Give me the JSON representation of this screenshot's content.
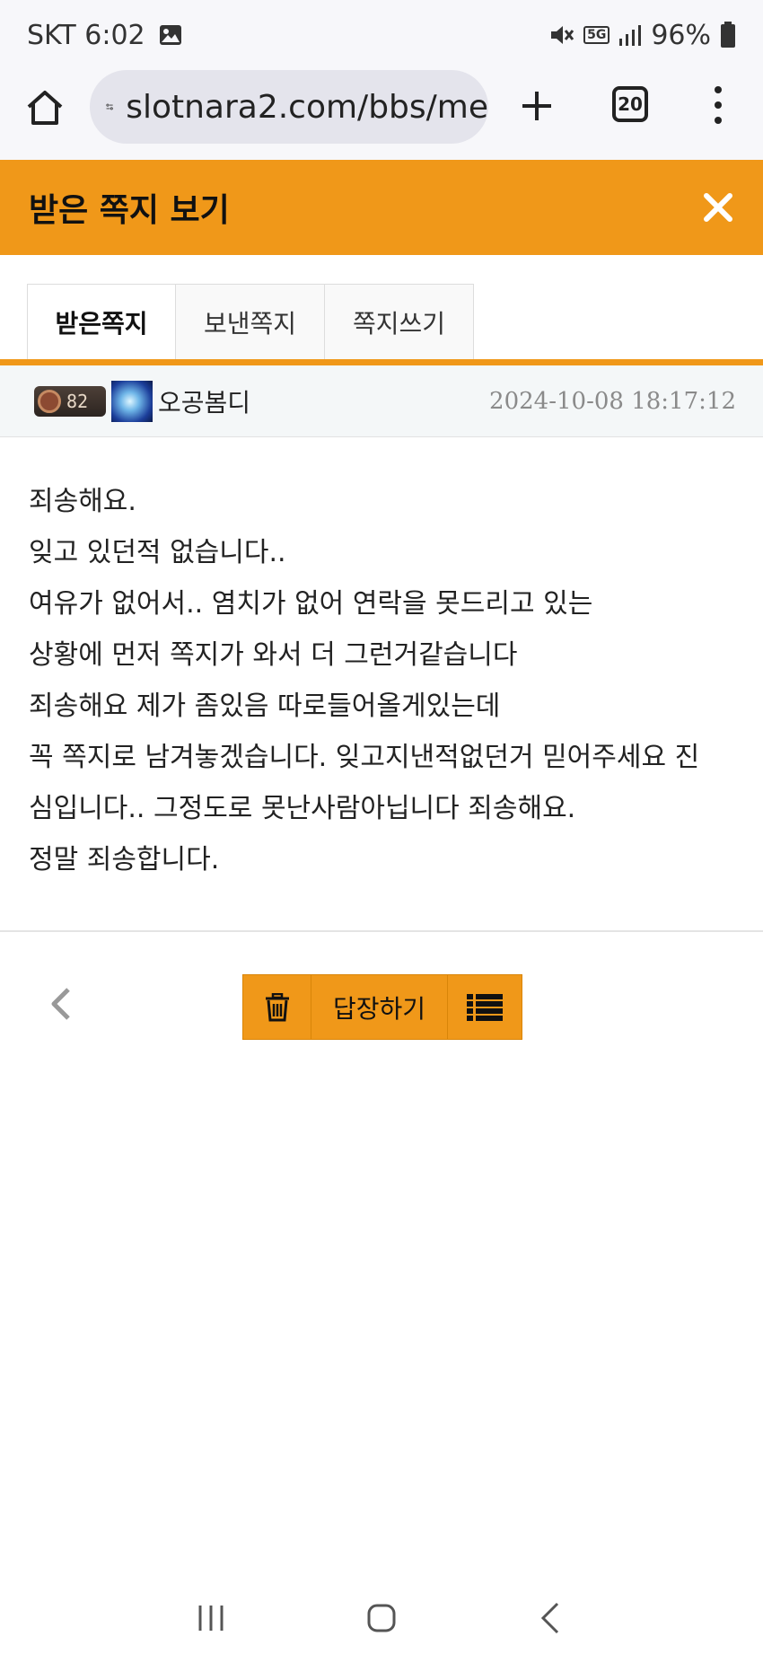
{
  "status_bar": {
    "carrier_time": "SKT 6:02",
    "network": "5G",
    "battery": "96%",
    "icons": [
      "image-icon",
      "mute-icon",
      "signal-icon",
      "battery-icon"
    ]
  },
  "browser": {
    "url": "slotnara2.com/bbs/me",
    "tab_count": "20",
    "icons": [
      "home-icon",
      "site-settings-icon",
      "plus-icon",
      "menu-icon"
    ]
  },
  "header": {
    "title": "받은 쪽지 보기",
    "accent_color": "#f09819"
  },
  "tabs": [
    {
      "label": "받은쪽지",
      "active": true
    },
    {
      "label": "보낸쪽지",
      "active": false
    },
    {
      "label": "쪽지쓰기",
      "active": false
    }
  ],
  "message": {
    "level": "82",
    "sender": "오공봄디",
    "date": "2024-10-08 18:17:12",
    "lines": [
      "죄송해요.",
      "잊고 있던적 없습니다..",
      "여유가 없어서.. 염치가 없어 연락을 못드리고 있는",
      "상황에 먼저 쪽지가 와서 더 그런거같습니다",
      "죄송해요 제가 좀있음 따로들어올게있는데",
      "꼭 쪽지로 남겨놓겠습니다. 잊고지낸적없던거 믿어주세요 진",
      "심입니다.. 그정도로 못난사람아닙니다 죄송해요.",
      "정말 죄송합니다."
    ]
  },
  "actions": {
    "reply_label": "답장하기"
  }
}
